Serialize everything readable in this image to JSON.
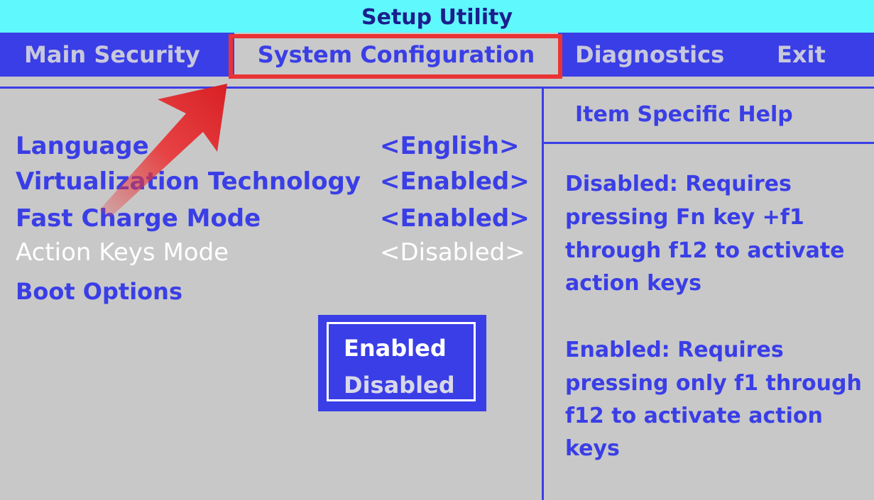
{
  "title": "Setup Utility",
  "menu": {
    "main_security": "Main Security",
    "system_configuration": "System Configuration",
    "diagnostics": "Diagnostics",
    "exit": "Exit"
  },
  "settings": [
    {
      "label": "Language",
      "value": "<English>"
    },
    {
      "label": "Virtualization Technology",
      "value": "<Enabled>"
    },
    {
      "label": "Fast Charge Mode",
      "value": "<Enabled>"
    },
    {
      "label": "Action Keys Mode",
      "value": "<Disabled>"
    }
  ],
  "boot_options": "Boot Options",
  "popup": {
    "options": [
      "Enabled",
      "Disabled"
    ]
  },
  "help": {
    "title": "Item Specific Help",
    "disabled_lines": [
      "Disabled: Requires",
      "pressing Fn key +f1",
      "through f12 to activate",
      "action keys"
    ],
    "enabled_lines": [
      "Enabled: Requires",
      "pressing only f1 through",
      "f12 to activate action",
      "keys"
    ]
  },
  "colors": {
    "title_bg": "#5ff8fc",
    "menu_bg": "#3a3ee6",
    "panel_bg": "#c8c8c8",
    "annotation_red": "#ea3335"
  },
  "icons": {
    "annotation_arrow": "red-arrow-icon"
  }
}
